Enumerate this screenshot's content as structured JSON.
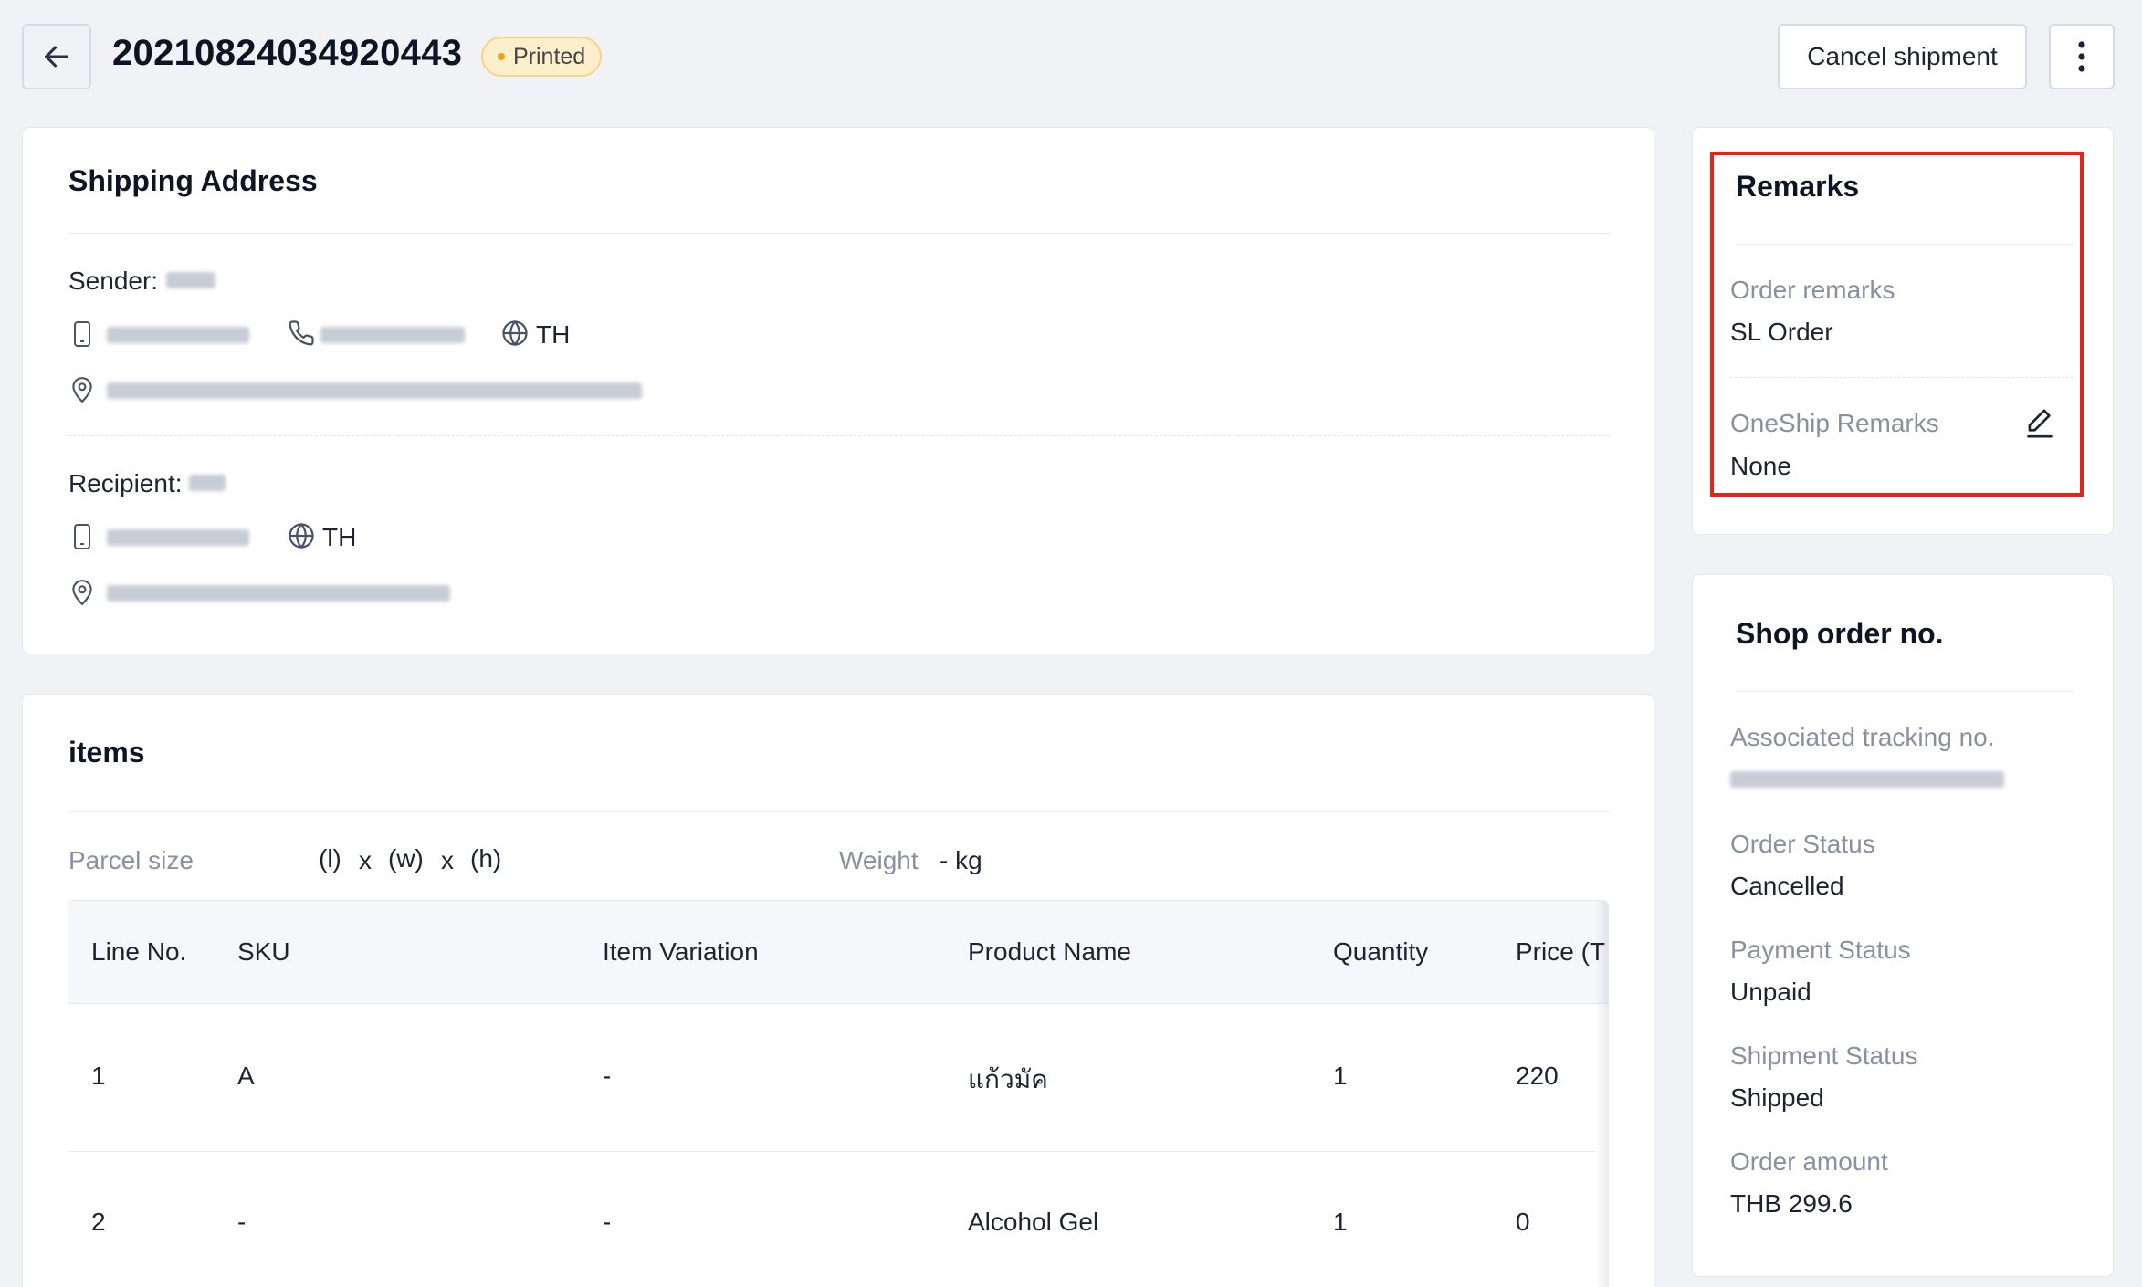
{
  "header": {
    "order_no": "20210824034920443",
    "status_badge": "Printed",
    "cancel_label": "Cancel shipment"
  },
  "shipping": {
    "title": "Shipping Address",
    "sender_label": "Sender:",
    "sender_country": "TH",
    "recipient_label": "Recipient:",
    "recipient_country": "TH"
  },
  "items": {
    "title": "items",
    "parcel_size_label": "Parcel size",
    "parcel_l": "(l)",
    "parcel_x1": "x",
    "parcel_w": "(w)",
    "parcel_x2": "x",
    "parcel_h": "(h)",
    "weight_label": "Weight",
    "weight_value": "- kg",
    "columns": [
      "Line No.",
      "SKU",
      "Item Variation",
      "Product Name",
      "Quantity",
      "Price (T"
    ],
    "rows": [
      [
        "1",
        "A",
        "-",
        "แก้วมัค",
        "1",
        "220"
      ],
      [
        "2",
        "-",
        "-",
        "Alcohol Gel",
        "1",
        "0"
      ]
    ]
  },
  "remarks": {
    "title": "Remarks",
    "order_remarks_label": "Order remarks",
    "order_remarks_value": "SL Order",
    "oneship_label": "OneShip Remarks",
    "oneship_value": "None"
  },
  "shop_order": {
    "title": "Shop order no.",
    "tracking_label": "Associated tracking no.",
    "order_status_label": "Order Status",
    "order_status_value": "Cancelled",
    "payment_status_label": "Payment Status",
    "payment_status_value": "Unpaid",
    "shipment_status_label": "Shipment Status",
    "shipment_status_value": "Shipped",
    "order_amount_label": "Order amount",
    "order_amount_value": "THB 299.6"
  },
  "colors": {
    "badge_bg": "#fdefcc",
    "badge_dot": "#f0a020",
    "highlight": "#e0261a",
    "muted_text": "#8791a3"
  },
  "icons": [
    "arrow-left-icon",
    "more-vertical-icon",
    "mobile-icon",
    "phone-icon",
    "globe-icon",
    "map-pin-icon",
    "edit-pencil-icon"
  ]
}
